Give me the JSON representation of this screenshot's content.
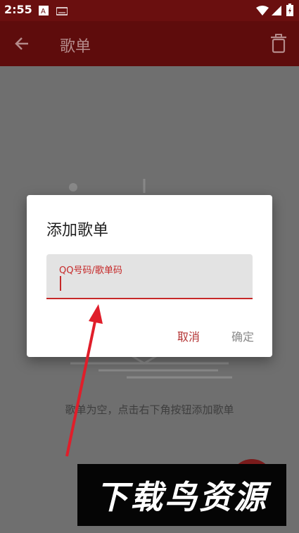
{
  "status_bar": {
    "time": "2:55"
  },
  "app_bar": {
    "title": "歌单",
    "back_icon": "arrow-back-icon",
    "delete_icon": "trash-icon"
  },
  "empty_state": {
    "message": "歌单为空，点击右下角按钮添加歌单"
  },
  "dialog": {
    "title": "添加歌单",
    "field_label": "QQ号码/歌单码",
    "field_value": "",
    "cancel_label": "取消",
    "ok_label": "确定"
  },
  "watermark": {
    "text": "下载鸟资源"
  },
  "colors": {
    "app_bar": "#5e0c0c",
    "accent": "#c62828",
    "scrim": "#6f6f6f"
  }
}
